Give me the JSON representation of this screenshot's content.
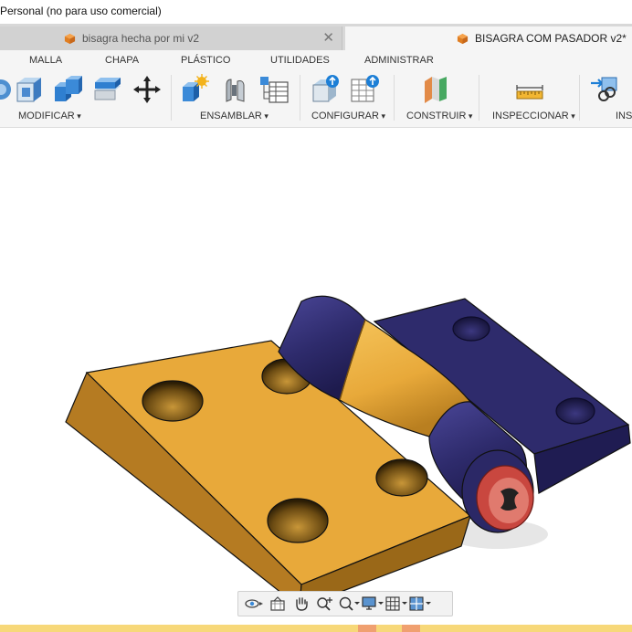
{
  "title_bar": {
    "text": "Personal (no para uso comercial)"
  },
  "tabs": [
    {
      "label": "bisagra hecha por mi v2",
      "active": false
    },
    {
      "label": "BISAGRA COM PASADOR v2*",
      "active": true
    }
  ],
  "ribbon": {
    "tabs": [
      "MALLA",
      "CHAPA",
      "PLÁSTICO",
      "UTILIDADES",
      "ADMINISTRAR"
    ],
    "groups": [
      "MODIFICAR",
      "ENSAMBLAR",
      "CONFIGURAR",
      "CONSTRUIR",
      "INSPECCIONAR",
      "INSE"
    ]
  },
  "colors": {
    "leaf_yellow": "#e8a93a",
    "leaf_navy": "#2e2b6c",
    "pin_red": "#c9473f",
    "ribbon_bg": "#f5f5f5"
  },
  "nav_toolbar": {
    "icons": [
      "orbit-icon",
      "look-at-icon",
      "pan-hand-icon",
      "zoom-icon",
      "fit-icon",
      "display-settings-icon",
      "grid-icon",
      "viewports-icon"
    ]
  }
}
